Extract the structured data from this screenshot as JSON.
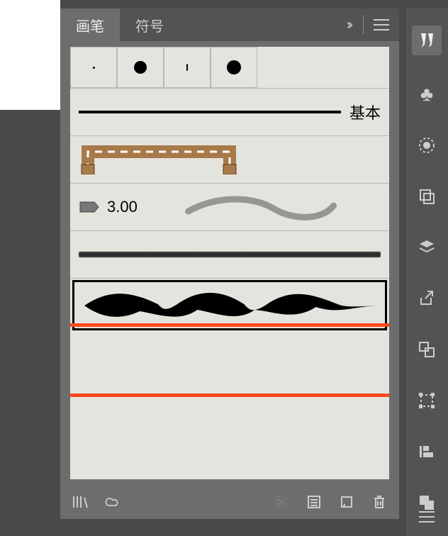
{
  "tabs": {
    "brushes": "画笔",
    "symbols": "符号"
  },
  "brush_list": {
    "basic_label": "基本",
    "calligraphic_value": "3.00",
    "dot_sizes": [
      3,
      18,
      2,
      20
    ]
  },
  "icons": {
    "chevrons": "››",
    "library": "library-icon",
    "cc": "creative-cloud-icon",
    "cut": "scissors-icon",
    "options": "options-icon",
    "new": "new-brush-icon",
    "delete": "trash-icon",
    "menu": "menu-icon"
  },
  "sidebar_tools": [
    "brushes-icon",
    "symbols-icon",
    "appearance-icon",
    "graphic-styles-icon",
    "layers-icon",
    "export-icon",
    "artboards-icon",
    "transform-icon",
    "align-icon",
    "pathfinder-icon"
  ]
}
